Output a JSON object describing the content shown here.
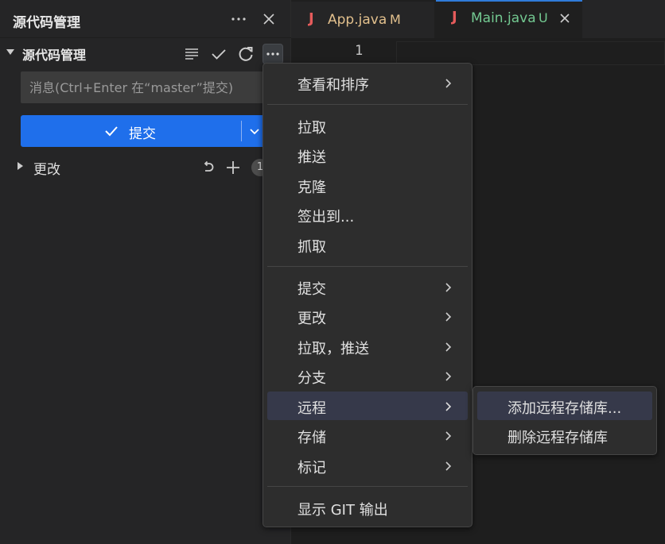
{
  "sidebar": {
    "title": "源代码管理",
    "more_icon": "ellipsis-icon",
    "close_icon": "close-icon",
    "repo_label": "源代码管理",
    "message_placeholder": "消息(Ctrl+Enter 在“master”提交)",
    "commit_label": "提交",
    "changes_label": "更改",
    "changes_count": "1"
  },
  "tabs": [
    {
      "icon": "J",
      "name": "App.java",
      "status": "M",
      "name_color": "#e2c08d"
    },
    {
      "icon": "J",
      "name": "Main.java",
      "status": "U",
      "name_color": "#73c991",
      "active": true
    }
  ],
  "editor": {
    "line_number": "1"
  },
  "menu": {
    "items": [
      {
        "label": "查看和排序",
        "submenu": true
      },
      {
        "label": "拉取"
      },
      {
        "label": "推送"
      },
      {
        "label": "克隆"
      },
      {
        "label": "签出到..."
      },
      {
        "label": "抓取"
      },
      {
        "label": "提交",
        "submenu": true
      },
      {
        "label": "更改",
        "submenu": true
      },
      {
        "label": "拉取，推送",
        "submenu": true
      },
      {
        "label": "分支",
        "submenu": true
      },
      {
        "label": "远程",
        "submenu": true,
        "highlighted": true
      },
      {
        "label": "存储",
        "submenu": true
      },
      {
        "label": "标记",
        "submenu": true
      },
      {
        "label": "显示 GIT 输出"
      }
    ]
  },
  "submenu": {
    "items": [
      {
        "label": "添加远程存储库...",
        "highlighted": true
      },
      {
        "label": "删除远程存储库"
      }
    ]
  },
  "colors": {
    "accent": "#1f6feb",
    "highlight": "#36394a",
    "app_java": "#e2c08d",
    "main_java": "#73c991",
    "java_icon": "#e55b5b"
  }
}
